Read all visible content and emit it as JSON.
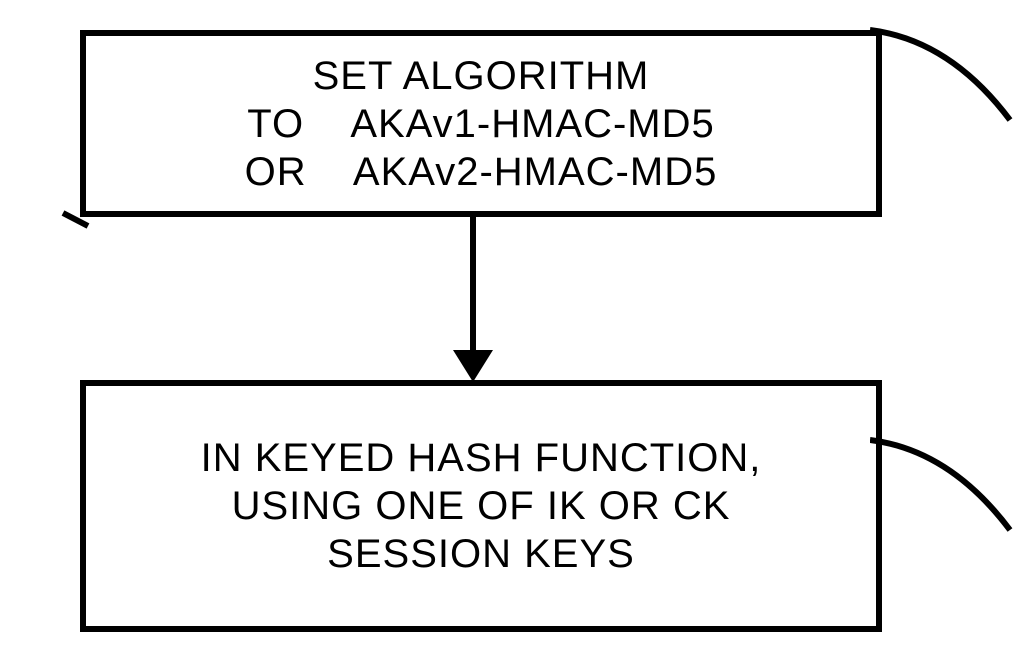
{
  "chart_data": {
    "type": "diagram",
    "nodes": [
      {
        "id": "box1",
        "lines": [
          "SET ALGORITHM",
          "TO    AKAv1-HMAC-MD5",
          "OR    AKAv2-HMAC-MD5"
        ]
      },
      {
        "id": "box2",
        "lines": [
          "IN KEYED HASH FUNCTION,",
          "USING ONE OF IK OR CK",
          "SESSION KEYS"
        ]
      }
    ],
    "edges": [
      {
        "from": "box1",
        "to": "box2",
        "type": "arrow"
      }
    ]
  }
}
